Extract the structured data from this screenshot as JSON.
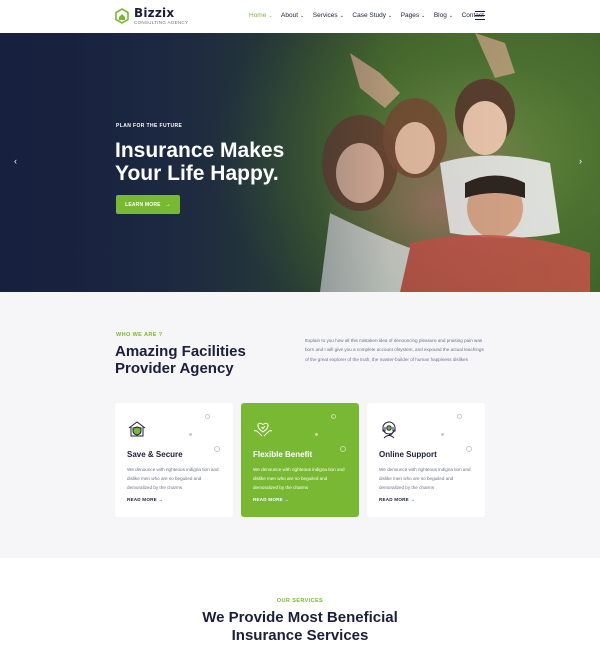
{
  "brand": {
    "name": "Bizzix",
    "tagline": "CONSULTING AGENCY",
    "accent_color": "#79b833",
    "dark_color": "#1b1f3b"
  },
  "nav": {
    "items": [
      {
        "label": "Home",
        "has_dropdown": true,
        "active": true
      },
      {
        "label": "About",
        "has_dropdown": true,
        "active": false
      },
      {
        "label": "Services",
        "has_dropdown": true,
        "active": false
      },
      {
        "label": "Case Study",
        "has_dropdown": true,
        "active": false
      },
      {
        "label": "Pages",
        "has_dropdown": true,
        "active": false
      },
      {
        "label": "Blog",
        "has_dropdown": true,
        "active": false
      },
      {
        "label": "Contact",
        "has_dropdown": false,
        "active": false
      }
    ],
    "menu_icon": "hamburger-icon"
  },
  "hero": {
    "subtitle": "PLAN FOR THE FUTURE",
    "title_line1": "Insurance Makes",
    "title_line2": "Your Life Happy.",
    "button_label": "LEARN MORE",
    "button_icon": "arrow-right-icon",
    "prev_icon": "chevron-left-icon",
    "next_icon": "chevron-right-icon"
  },
  "about": {
    "subtitle": "WHO WE ARE ?",
    "title_line1": "Amazing Facilities",
    "title_line2": "Provider Agency",
    "description": "Explain to you how all this mistaken idea of denouncing pleasure and praising pain was born and I will give you a complete account ofsystem, and expound the actual teachings of the great explorer of the truth, the master-builder of human happiness dislikes"
  },
  "features": [
    {
      "title": "Save & Secure",
      "text": "We denounce with righteous indigna tion and dislike men who are so beguiled and demoralized by the charms",
      "link": "READ MORE",
      "icon": "house-shield-icon",
      "highlighted": false
    },
    {
      "title": "Flexible Benefit",
      "text": "We denounce with righteous indigna tion and dislike men who are so beguiled and demoralized by the charms",
      "link": "READ MORE",
      "icon": "heart-hands-icon",
      "highlighted": true
    },
    {
      "title": "Online Support",
      "text": "We denounce with righteous indigna tion and dislike men who are so beguiled and demoralized by the charms",
      "link": "READ MORE",
      "icon": "support-agent-icon",
      "highlighted": false
    }
  ],
  "services": {
    "subtitle": "OUR SERVICES",
    "title_line1": "We Provide Most Beneficial",
    "title_line2": "Insurance Services"
  }
}
